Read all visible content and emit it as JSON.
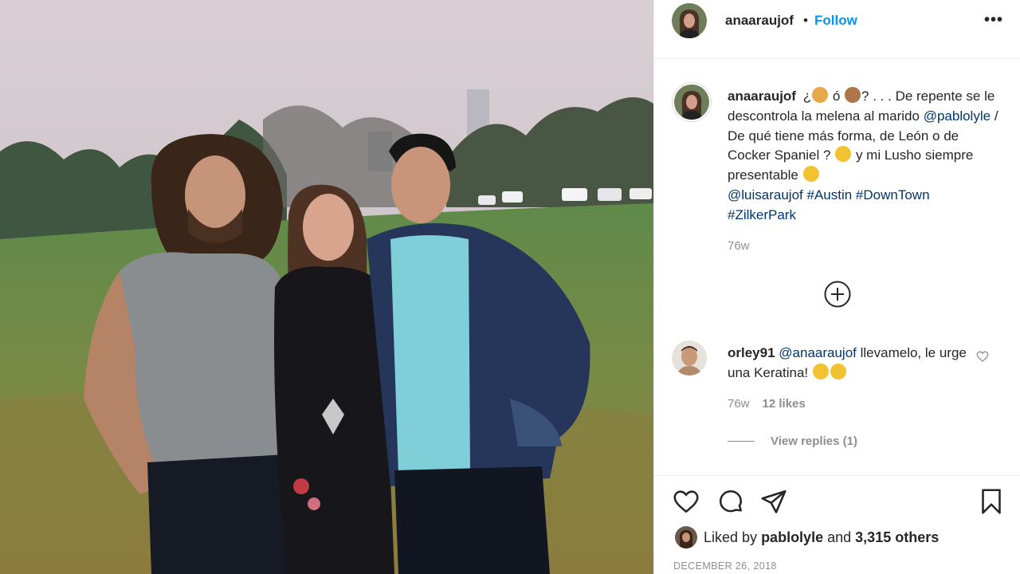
{
  "post": {
    "username": "anaaraujof",
    "separator": "•",
    "follow_label": "Follow",
    "more_label": "•••"
  },
  "caption": {
    "username": "anaaraujof",
    "text_1": "¿",
    "text_2": "ó",
    "text_3": "? . . . De repente se le descontrola la melena al marido",
    "mention_1": "@pablolyle",
    "text_4": "/ De qué tiene más forma, de León o de Cocker Spaniel ?",
    "text_5": "y mi Lusho siempre presentable",
    "mention_2": "@luisaraujof",
    "hashtag_1": "#Austin",
    "hashtag_2": "#DownTown",
    "hashtag_3": "#ZilkerPark",
    "time": "76w",
    "emojis": [
      "lion-emoji",
      "dog-emoji",
      "thinking-emoji",
      "woozy-emoji"
    ]
  },
  "comment": {
    "username": "orley91",
    "mention": "@anaaraujof",
    "text": "llevamelo, le urge una Keratina!",
    "emojis": [
      "joy-emoji",
      "joy-emoji"
    ],
    "time": "76w",
    "likes": "12 likes",
    "view_replies": "View replies (1)"
  },
  "likes": {
    "prefix": "Liked by",
    "user": "pablolyle",
    "middle": "and",
    "others": "3,315 others"
  },
  "date": "DECEMBER 26, 2018",
  "colors": {
    "link": "#00376b",
    "follow": "#0095f6",
    "muted": "#8e8e8e",
    "border": "#efefef"
  }
}
